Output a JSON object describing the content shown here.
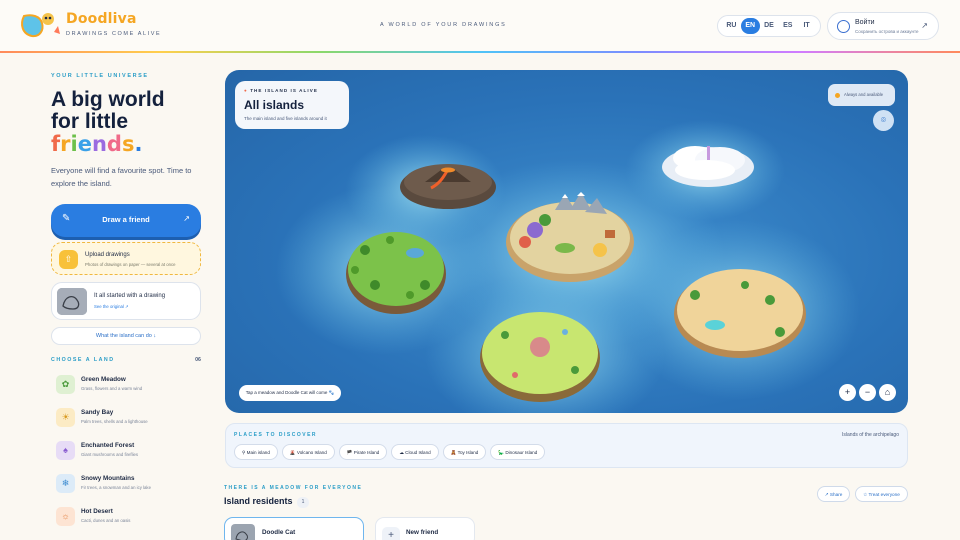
{
  "header": {
    "logo_word": "Doodliva",
    "logo_tagline": "DRAWINGS COME ALIVE",
    "center_text": "A WORLD OF YOUR DRAWINGS",
    "languages": [
      "RU",
      "EN",
      "DE",
      "ES",
      "IT"
    ],
    "active_language": "EN",
    "login": {
      "title": "Войти",
      "subtitle": "Сохранить острова и аккаунте"
    }
  },
  "hero": {
    "eyebrow": "YOUR LITTLE UNIVERSE",
    "title_line1": "A big world",
    "title_line2": "for little",
    "title_colored": [
      "f",
      "r",
      "i",
      "e",
      "n",
      "d",
      "s",
      "."
    ],
    "lead": "Everyone will find a favourite spot. Time to explore the island."
  },
  "actions": {
    "draw_label": "Draw a friend",
    "upload_title": "Upload drawings",
    "upload_subtitle": "Photos of drawings on paper — several at once",
    "origin_title": "It all started with a drawing",
    "origin_link": "See the original ↗",
    "can_do": "What the island can do ↓"
  },
  "lands": {
    "heading": "CHOOSE A LAND",
    "count": "06",
    "items": [
      {
        "name": "Green Meadow",
        "desc": "Grass, flowers and a warm wind",
        "icon": "✿",
        "color": "#dff0d2"
      },
      {
        "name": "Sandy Bay",
        "desc": "Palm trees, shells and a lighthouse",
        "icon": "☀",
        "color": "#fcebc4"
      },
      {
        "name": "Enchanted Forest",
        "desc": "Giant mushrooms and fireflies",
        "icon": "♠",
        "color": "#e7dcf6"
      },
      {
        "name": "Snowy Mountains",
        "desc": "Fir trees, a snowman and an icy lake",
        "icon": "❄",
        "color": "#dcebf8"
      },
      {
        "name": "Hot Desert",
        "desc": "Cacti, dunes and an oasis",
        "icon": "☼",
        "color": "#fde4d3"
      }
    ]
  },
  "map": {
    "status": "THE ISLAND IS ALIVE",
    "title": "All islands",
    "subtitle": "The main island and five islands around it",
    "availability": "Always and available",
    "tip": "Tap a meadow and Doodle Cat will come 🐾",
    "zoom_in": "+",
    "zoom_out": "−",
    "home": "⌂",
    "camera": "⌾"
  },
  "places": {
    "heading": "PLACES TO DISCOVER",
    "right_label": "Islands of the archipelago",
    "chips": [
      "⚲ Main island",
      "🌋 Volcano Island",
      "🏴 Pirate Island",
      "☁ Cloud Island",
      "🧸 Toy Island",
      "🦕 Dinosaur Island"
    ]
  },
  "residents": {
    "eyebrow": "THERE IS A MEADOW FOR EVERYONE",
    "title": "Island residents",
    "count": "1",
    "share": "↗ Share",
    "treat": "☆ Treat everyone",
    "cards": [
      "Doodle Cat",
      "New friend"
    ]
  }
}
